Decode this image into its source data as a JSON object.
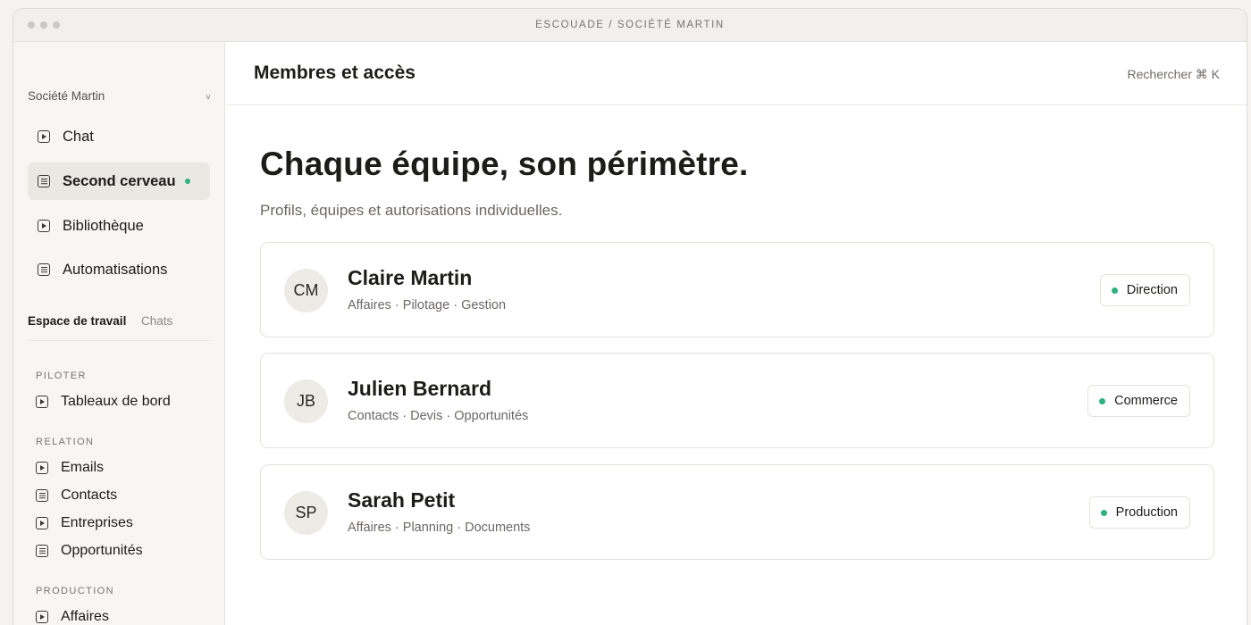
{
  "window": {
    "title": "ESCOUADE / SOCIÉTÉ MARTIN"
  },
  "sidebar": {
    "org_name": "Société Martin",
    "org_chevron": "˅",
    "nav": [
      {
        "label": "Chat",
        "icon": "play-square-icon"
      },
      {
        "label": "Second cerveau",
        "icon": "document-icon",
        "active": true,
        "indicator": "green-dot"
      },
      {
        "label": "Bibliothèque",
        "icon": "play-square-icon"
      },
      {
        "label": "Automatisations",
        "icon": "document-icon"
      }
    ],
    "tabs": {
      "workspace": "Espace de travail",
      "chats": "Chats"
    },
    "sections": [
      {
        "label": "PILOTER",
        "items": [
          {
            "label": "Tableaux de bord",
            "icon": "play-square-icon"
          }
        ]
      },
      {
        "label": "RELATION",
        "items": [
          {
            "label": "Emails",
            "icon": "play-square-icon"
          },
          {
            "label": "Contacts",
            "icon": "document-icon"
          },
          {
            "label": "Entreprises",
            "icon": "play-square-icon"
          },
          {
            "label": "Opportunités",
            "icon": "document-icon"
          }
        ]
      },
      {
        "label": "PRODUCTION",
        "items": [
          {
            "label": "Affaires",
            "icon": "play-square-icon"
          }
        ]
      }
    ]
  },
  "header": {
    "title": "Membres et accès",
    "search_hint": "Rechercher ⌘ K"
  },
  "hero": {
    "title": "Chaque équipe, son périmètre.",
    "subtitle": "Profils, équipes et autorisations individuelles."
  },
  "members": [
    {
      "initials": "CM",
      "name": "Claire Martin",
      "permissions": "Affaires · Pilotage · Gestion",
      "team": "Direction"
    },
    {
      "initials": "JB",
      "name": "Julien Bernard",
      "permissions": "Contacts · Devis · Opportunités",
      "team": "Commerce"
    },
    {
      "initials": "SP",
      "name": "Sarah Petit",
      "permissions": "Affaires · Planning · Documents",
      "team": "Production"
    }
  ],
  "colors": {
    "accent_green": "#2fb07f",
    "sidebar_bg": "#f7f6f2",
    "active_bg": "#e9e8e3"
  }
}
